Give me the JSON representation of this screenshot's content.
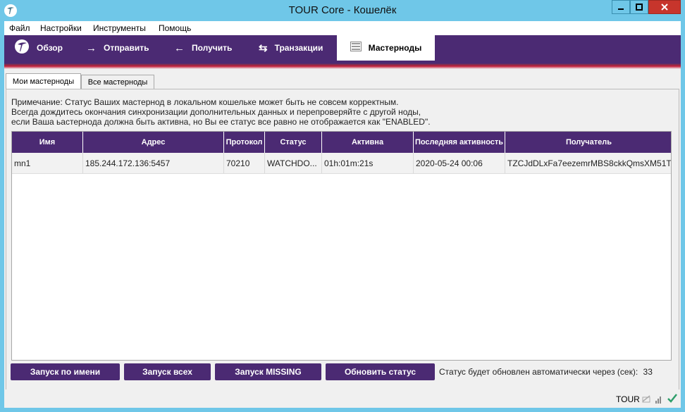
{
  "window": {
    "title": "TOUR Core - Кошелёк"
  },
  "menu": [
    "Файл",
    "Настройки",
    "Инструменты",
    "Помощь"
  ],
  "toolbar": {
    "items": [
      {
        "label": "Обзор",
        "icon": "logo-icon"
      },
      {
        "label": "Отправить",
        "icon": "arrow-right-icon"
      },
      {
        "label": "Получить",
        "icon": "arrow-left-icon"
      },
      {
        "label": "Транзакции",
        "icon": "transactions-icon"
      },
      {
        "label": "Мастерноды",
        "icon": "masternodes-icon"
      }
    ],
    "active_index": 4,
    "accent_color": "#4b2a73"
  },
  "tabs": [
    {
      "label": "Мои мастерноды",
      "active": true
    },
    {
      "label": "Все мастерноды",
      "active": false
    }
  ],
  "note": {
    "line1": "Примечание: Статус Ваших мастернод в локальном кошельке может быть не совсем корректным.",
    "line2": "Всегда дождитесь окончания синхронизации дополнительных данных и перепроверяйте с другой ноды,",
    "line3": "если Ваша ьастернода должна быть активна, но Вы ее статус все равно не отображается как \"ENABLED\"."
  },
  "table": {
    "columns": [
      "Имя",
      "Адрес",
      "Протокол",
      "Статус",
      "Активна",
      "Последняя активность",
      "Получатель"
    ],
    "rows": [
      [
        "mn1",
        "185.244.172.136:5457",
        "70210",
        "WATCHDO...",
        "01h:01m:21s",
        "2020-05-24 00:06",
        "TZCJdDLxFa7eezemrMBS8ckkQmsXM51T..."
      ]
    ]
  },
  "buttons": {
    "start_alias": "Запуск по имени",
    "start_all": "Запуск всех",
    "start_missing": "Запуск MISSING",
    "update_status": "Обновить статус"
  },
  "autoupdate": {
    "label": "Статус будет обновлен автоматически через (сек):",
    "seconds": "33"
  },
  "statusbar": {
    "unit": "TOUR",
    "synced_color": "#2e9e6a"
  }
}
